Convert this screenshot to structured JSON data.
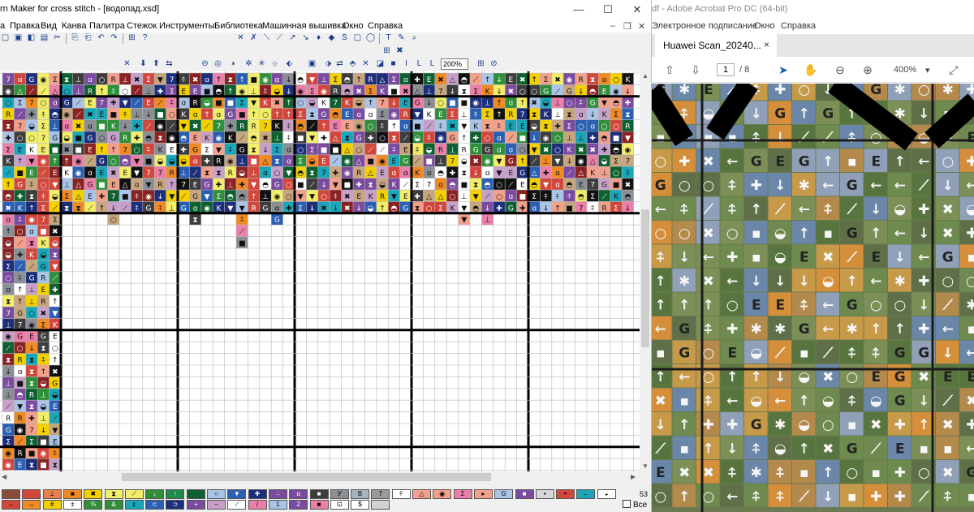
{
  "pm": {
    "title": "rn Maker for cross stitch - [водопад.xsd]",
    "window_buttons": [
      "—",
      "☐",
      "✕"
    ],
    "menu": [
      "а",
      "Правка",
      "Вид",
      "Канва",
      "Палитра",
      "Стежок",
      "Инструменты",
      "Библиотека",
      "Машинная вышивка",
      "Окно",
      "Справка"
    ],
    "mdi_controls": [
      "–",
      "❐",
      "✕"
    ],
    "zoom": "200%",
    "colors": {
      "red": "#d2473c",
      "dark_red": "#8b2323",
      "yellow": "#f3d000",
      "light_yellow": "#f2ee6a",
      "green": "#2f8f3a",
      "dark_green": "#0f6030",
      "light_blue": "#a9c4e6",
      "blue": "#2b5fb2",
      "navy": "#1d2f7a",
      "purple": "#7a4b9e",
      "pink": "#ea7fa8",
      "salmon": "#f2a08a",
      "gray": "#8a8f96",
      "dark": "#3d3d3d",
      "black": "#111111",
      "white": "#ffffff",
      "teal": "#1aa6b9",
      "orange": "#f08a24",
      "mauve": "#c6a0c8",
      "tan": "#c7a57e"
    },
    "palette_count": "53",
    "palette_all": "Все",
    "palette_row1": [
      {
        "c": "#8b4a3a",
        "s": ""
      },
      {
        "c": "#d2473c",
        "s": ""
      },
      {
        "c": "#ea7f4e",
        "s": "⊥"
      },
      {
        "c": "#f08a24",
        "s": "■"
      },
      {
        "c": "#f3d000",
        "s": "✖"
      },
      {
        "c": "#f2ee6a",
        "s": "⧗"
      },
      {
        "c": "#f2ee6a",
        "s": "⟋"
      },
      {
        "c": "#2f8f3a",
        "s": "↓"
      },
      {
        "c": "#1f8b4c",
        "s": "↑"
      },
      {
        "c": "#0f6030",
        "s": ""
      },
      {
        "c": "#a9c4e6",
        "s": "○"
      },
      {
        "c": "#2b5fb2",
        "s": "▼"
      },
      {
        "c": "#1d2f7a",
        "s": "✚"
      },
      {
        "c": "#7a4b9e",
        "s": "∴"
      },
      {
        "c": "#7a4b9e",
        "s": "ɑ"
      },
      {
        "c": "#3d3d3d",
        "s": "■"
      },
      {
        "c": "#8a8f96",
        "s": "У"
      },
      {
        "c": "#a9b2bf",
        "s": "В"
      },
      {
        "c": "#9a9a9a",
        "s": "7"
      },
      {
        "c": "#ffffff",
        "s": "⍏"
      },
      {
        "c": "#f2a08a",
        "s": "△"
      },
      {
        "c": "#f2a08a",
        "s": "◉"
      },
      {
        "c": "#ea7fa8",
        "s": "Σ"
      },
      {
        "c": "#f2a08a",
        "s": "▸"
      },
      {
        "c": "#a9c4e6",
        "s": "G"
      },
      {
        "c": "#7a4b9e",
        "s": "■"
      },
      {
        "c": "#d6d6d6",
        "s": "▪"
      },
      {
        "c": "#d2473c",
        "s": "◓"
      },
      {
        "c": "#1aa6b9",
        "s": "←"
      },
      {
        "c": "#ffffff",
        "s": "◒"
      }
    ],
    "palette_row2": [
      {
        "c": "#d2473c",
        "s": "⇔"
      },
      {
        "c": "#f08a24",
        "s": "↔"
      },
      {
        "c": "#f3d000",
        "s": "#"
      },
      {
        "c": "#ffffff",
        "s": "±"
      },
      {
        "c": "#2f8f3a",
        "s": "⅜"
      },
      {
        "c": "#2f8f3a",
        "s": "&"
      },
      {
        "c": "#1aa6b9",
        "s": "ɛ"
      },
      {
        "c": "#2b5fb2",
        "s": "⊂"
      },
      {
        "c": "#1d2f7a",
        "s": "⊃"
      },
      {
        "c": "#7a4b9e",
        "s": "+"
      },
      {
        "c": "#c6a0c8",
        "s": "−"
      },
      {
        "c": "#ffffff",
        "s": "⟋"
      },
      {
        "c": "#ea7fa8",
        "s": "/"
      },
      {
        "c": "#a9c4e6",
        "s": "1"
      },
      {
        "c": "#7a4b9e",
        "s": "2"
      },
      {
        "c": "#ea7fa8",
        "s": "■"
      },
      {
        "c": "#ffffff",
        "s": "⊡"
      },
      {
        "c": "#ffffff",
        "s": "$"
      },
      {
        "c": "#d2d2d2",
        "s": ""
      }
    ]
  },
  "acro": {
    "title": "df - Adobe Acrobat Pro DC (64-bit)",
    "menu": [
      "Электронное подписание",
      "Окно",
      "Справка"
    ],
    "tab_label": "Huawei Scan_20240...",
    "tab_close": "×",
    "page_current": "1",
    "page_total": "/ 8",
    "zoom": "400%",
    "zoom_arrow": "▾"
  }
}
